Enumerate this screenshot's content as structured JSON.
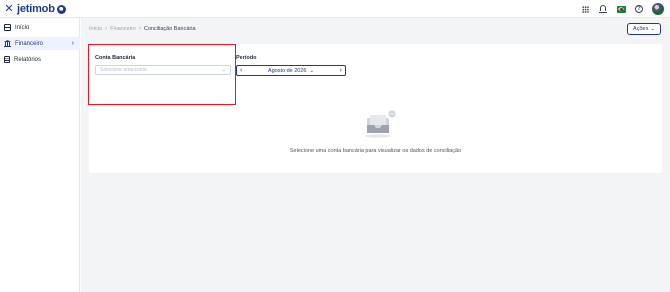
{
  "topbar": {
    "close_icon": "close-icon",
    "brand": "jetimob",
    "icons": [
      "apps-grid-icon",
      "bell-icon",
      "brazil-flag-icon",
      "help-icon",
      "user-avatar"
    ]
  },
  "sidebar": {
    "items": [
      {
        "label": "Início",
        "icon": "home-icon",
        "active": false
      },
      {
        "label": "Financeiro",
        "icon": "bank-icon",
        "active": true
      },
      {
        "label": "Relatórios",
        "icon": "report-icon",
        "active": false
      }
    ]
  },
  "breadcrumb": {
    "items": [
      "Início",
      "Financeiro",
      "Conciliação Bancária"
    ]
  },
  "actions_button": {
    "label": "Ações",
    "icon": "chevron-down-icon"
  },
  "filters": {
    "account_label": "Conta Bancária",
    "account_placeholder": "Selecione uma conta",
    "period_label": "Período",
    "period_value": "Agosto de 2026"
  },
  "empty_state": {
    "message": "Selecione uma conta bancária para visualizar os dados de conciliação"
  },
  "colors": {
    "brand": "#1e3a8a",
    "highlight": "#e11d2a",
    "background": "#f3f4f6"
  }
}
